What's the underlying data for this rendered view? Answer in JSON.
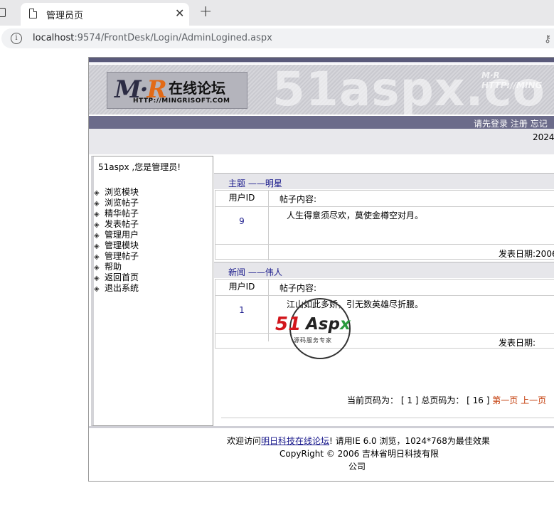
{
  "browser": {
    "tab_title": "管理员页",
    "url_host": "localhost",
    "url_path": ":9574/FrontDesk/Login/AdminLogined.aspx",
    "close_glyph": "✕",
    "new_tab_glyph": "+"
  },
  "banner": {
    "logo_mr_m": "M",
    "logo_mr_dot": "·",
    "logo_mr_r": "R",
    "logo_cn": "在线论坛",
    "logo_url": "HTTP://MINGRISOFT.COM",
    "bg_text": "51aspx.co",
    "bg_small": "M·R HTTP://MING"
  },
  "nav": {
    "login": "请先登录",
    "register": "注册",
    "forgot": "忘记"
  },
  "date_text": "2024,",
  "sidebar": {
    "welcome": "51aspx ,您是管理员!",
    "bullet_glyph": "◈",
    "items": [
      "浏览模块",
      "浏览帖子",
      "精华帖子",
      "发表帖子",
      "管理用户",
      "管理模块",
      "管理帖子",
      "帮助",
      "返回首页",
      "退出系统"
    ]
  },
  "posts": [
    {
      "header": "主题 ——明星",
      "id_label": "用户ID",
      "content_label": "帖子内容:",
      "id": "9",
      "body": "人生得意须尽欢，莫使金樽空对月。",
      "date_label": "发表日期:2006"
    },
    {
      "header": "新闻 ——伟人",
      "id_label": "用户ID",
      "content_label": "帖子内容:",
      "id": "1",
      "body": "江山如此多娇，引无数英雄尽折腰。",
      "date_label": "发表日期:"
    }
  ],
  "pager": {
    "current_label": "当前页码为：",
    "current": "[ 1 ]",
    "total_label": "总页码为：",
    "total": "[ 16 ]",
    "first": "第一页",
    "prev": "上一页"
  },
  "watermark": {
    "num": "51",
    "brand_a": "Asp",
    "brand_x": "x",
    "sub": "源码服务专家"
  },
  "footer": {
    "prefix": "欢迎访问",
    "link": "明日科技在线论坛",
    "suffix": "! 请用IE 6.0 浏览，1024*768为最佳效果",
    "copyright": "CopyRight © 2006 吉林省明日科技有限",
    "company_tail": "公司"
  },
  "colors": {
    "nav_band": "#6b6b8a",
    "link_blue": "#1a1a8c",
    "pager_link": "#c43d0a"
  }
}
